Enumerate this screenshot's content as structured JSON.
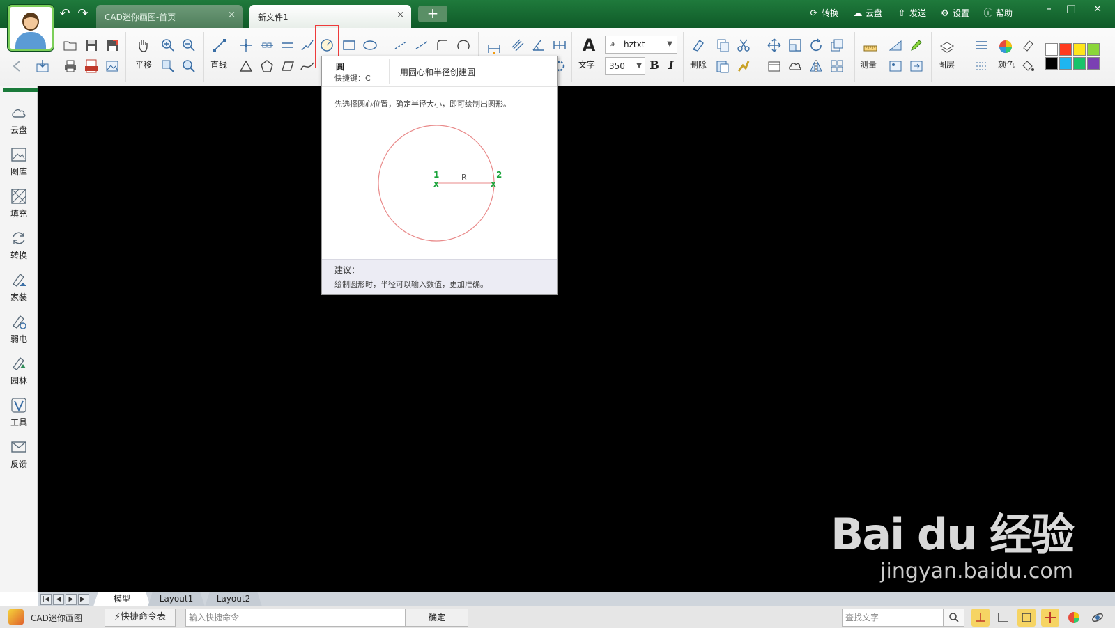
{
  "titlebar": {
    "tabs": [
      {
        "label": "CAD迷你画图-首页",
        "close": "×"
      },
      {
        "label": "新文件1",
        "close": "×"
      }
    ],
    "add_tab": "+",
    "right_actions": [
      {
        "label": "转换",
        "icon": "refresh-icon"
      },
      {
        "label": "云盘",
        "icon": "cloud-icon"
      },
      {
        "label": "发送",
        "icon": "send-icon"
      },
      {
        "label": "设置",
        "icon": "gear-icon"
      },
      {
        "label": "帮助",
        "icon": "help-icon"
      }
    ],
    "window_controls": {
      "minimize": "–",
      "maximize": "□",
      "close": "×"
    }
  },
  "ribbon": {
    "pan_label": "平移",
    "line_label": "直线",
    "text_label": "文字",
    "font_name": "hztxt",
    "font_size": "350",
    "bold": "B",
    "italic": "I",
    "delete_label": "删除",
    "measure_label": "测量",
    "layer_label": "图层",
    "color_label": "颜色",
    "palette": [
      "#ffffff",
      "#ff3b1f",
      "#ffe51a",
      "#8bd63a",
      "#000000",
      "#1fb5f0",
      "#18c36a",
      "#7b3fb3"
    ]
  },
  "sidebar": {
    "items": [
      {
        "label": "云盘",
        "icon": "cloud-icon"
      },
      {
        "label": "图库",
        "icon": "gallery-icon"
      },
      {
        "label": "填充",
        "icon": "hatch-icon"
      },
      {
        "label": "转换",
        "icon": "convert-icon"
      },
      {
        "label": "家装",
        "icon": "home-decor-icon"
      },
      {
        "label": "弱电",
        "icon": "low-voltage-icon"
      },
      {
        "label": "园林",
        "icon": "garden-icon"
      },
      {
        "label": "工具",
        "icon": "tools-icon"
      },
      {
        "label": "反馈",
        "icon": "mail-icon"
      }
    ]
  },
  "tooltip": {
    "name": "圆",
    "shortcut": "快捷键：C",
    "summary": "用圆心和半径创建圆",
    "description": "先选择圆心位置，确定半径大小，即可绘制出圆形。",
    "diagram": {
      "point1": "1",
      "point2": "2",
      "radius_label": "R",
      "marker": "x"
    },
    "tip_title": "建议：",
    "tip_text": "绘制圆形时，半径可以输入数值，更加准确。"
  },
  "layout_tabs": [
    "模型",
    "Layout1",
    "Layout2"
  ],
  "nav_arrows": [
    "|◀",
    "◀",
    "▶",
    "▶|"
  ],
  "watermark": {
    "main": "Bai du 经验",
    "url": "jingyan.baidu.com"
  },
  "statusbar": {
    "app_name": "CAD迷你画图",
    "quick_cmd": "⚡快捷命令表",
    "cmd_placeholder": "输入快捷命令",
    "ok_label": "确定",
    "search_placeholder": "查找文字"
  }
}
